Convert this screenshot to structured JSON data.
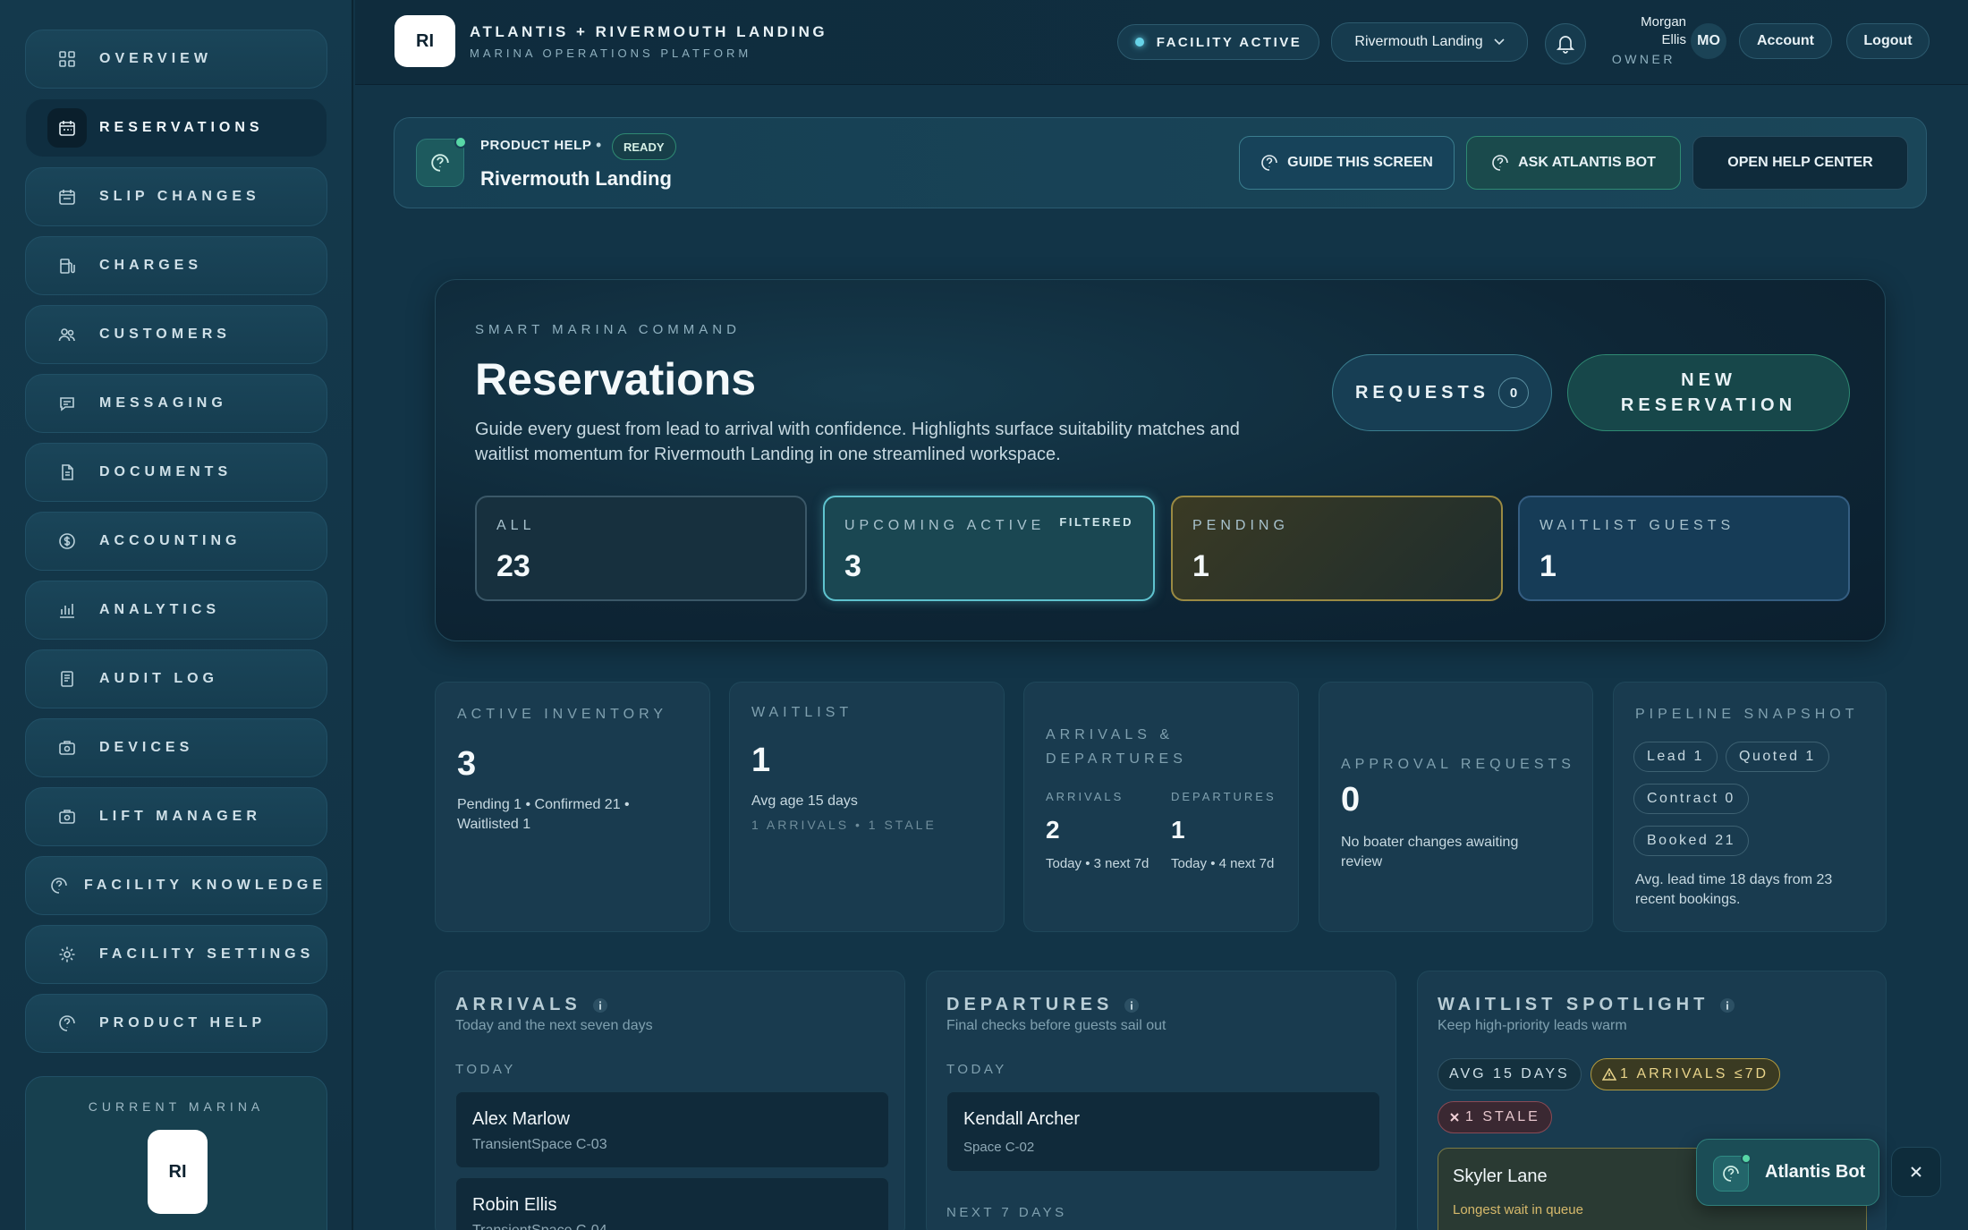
{
  "sidebar": {
    "items": [
      {
        "label": "OVERVIEW",
        "icon": "grid-icon"
      },
      {
        "label": "RESERVATIONS",
        "icon": "calendar-icon",
        "active": true
      },
      {
        "label": "SLIP CHANGES",
        "icon": "calendar-swap-icon"
      },
      {
        "label": "CHARGES",
        "icon": "fuel-icon"
      },
      {
        "label": "CUSTOMERS",
        "icon": "users-icon"
      },
      {
        "label": "MESSAGING",
        "icon": "message-icon"
      },
      {
        "label": "DOCUMENTS",
        "icon": "document-icon"
      },
      {
        "label": "ACCOUNTING",
        "icon": "dollar-icon"
      },
      {
        "label": "ANALYTICS",
        "icon": "chart-icon"
      },
      {
        "label": "AUDIT LOG",
        "icon": "log-icon"
      },
      {
        "label": "DEVICES",
        "icon": "device-icon"
      },
      {
        "label": "LIFT MANAGER",
        "icon": "lift-icon"
      },
      {
        "label": "FACILITY KNOWLEDGE",
        "icon": "help-icon"
      },
      {
        "label": "FACILITY SETTINGS",
        "icon": "gear-icon"
      },
      {
        "label": "PRODUCT HELP",
        "icon": "help-icon"
      }
    ],
    "current_marina": {
      "label": "CURRENT MARINA",
      "logo": "RI"
    }
  },
  "header": {
    "logo": "RI",
    "title": "ATLANTIS + RIVERMOUTH LANDING",
    "subtitle": "MARINA OPERATIONS PLATFORM",
    "facility_status": "FACILITY ACTIVE",
    "marina_select": "Rivermouth Landing",
    "user_name": "Morgan Ellis",
    "user_role": "OWNER",
    "user_initials": "MO",
    "account_label": "Account",
    "logout_label": "Logout"
  },
  "help_bar": {
    "label": "PRODUCT HELP",
    "separator": "•",
    "status": "READY",
    "marina": "Rivermouth Landing",
    "guide_label": "GUIDE THIS SCREEN",
    "ask_label": "ASK ATLANTIS BOT",
    "open_label": "OPEN HELP CENTER"
  },
  "hero": {
    "eyebrow": "SMART MARINA COMMAND",
    "title": "Reservations",
    "description": "Guide every guest from lead to arrival with confidence. Highlights surface suitability matches and waitlist momentum for Rivermouth Landing in one streamlined workspace.",
    "requests_label": "REQUESTS",
    "requests_count": "0",
    "new_reservation_label": "NEW RESERVATION",
    "stats": {
      "all": {
        "label": "ALL",
        "value": "23"
      },
      "upcoming": {
        "label": "UPCOMING ACTIVE",
        "value": "3",
        "filter": "FILTERED"
      },
      "pending": {
        "label": "PENDING",
        "value": "1"
      },
      "waitlist": {
        "label": "WAITLIST GUESTS",
        "value": "1"
      }
    }
  },
  "metrics": {
    "inventory": {
      "label": "ACTIVE INVENTORY",
      "value": "3",
      "sub": "Pending 1 • Confirmed 21 • Waitlisted 1"
    },
    "waitlist": {
      "label": "WAITLIST",
      "value": "1",
      "sub": "Avg age 15 days",
      "muted": "1 ARRIVALS • 1 STALE"
    },
    "arrdep": {
      "label": "ARRIVALS & DEPARTURES",
      "arrivals_label": "ARRIVALS",
      "arrivals_value": "2",
      "arrivals_sub": "Today • 3 next 7d",
      "departures_label": "DEPARTURES",
      "departures_value": "1",
      "departures_sub": "Today • 4 next 7d"
    },
    "approval": {
      "label": "APPROVAL REQUESTS",
      "value": "0",
      "sub": "No boater changes awaiting review"
    },
    "pipeline": {
      "label": "PIPELINE SNAPSHOT",
      "chips": [
        "Lead 1",
        "Quoted 1",
        "Contract 0",
        "Booked 21"
      ],
      "sub": "Avg. lead time 18 days from 23 recent bookings."
    }
  },
  "arrivals": {
    "title": "ARRIVALS",
    "subtitle": "Today and the next seven days",
    "section": "TODAY",
    "rows": [
      {
        "name": "Alex Marlow",
        "space": "TransientSpace C-03"
      },
      {
        "name": "Robin Ellis",
        "space": "TransientSpace C-04"
      }
    ]
  },
  "departures": {
    "title": "DEPARTURES",
    "subtitle": "Final checks before guests sail out",
    "section_today": "TODAY",
    "section_next": "NEXT 7 DAYS",
    "rows": [
      {
        "name": "Kendall Archer",
        "space": "Space C-02"
      }
    ]
  },
  "spotlight": {
    "title": "WAITLIST SPOTLIGHT",
    "subtitle": "Keep high-priority leads warm",
    "chip_avg": "AVG 15 DAYS",
    "chip_arrivals": "1 ARRIVALS ≤7D",
    "chip_stale": "1 STALE",
    "card_name": "Skyler Lane",
    "card_note": "Longest wait in queue"
  },
  "bot": {
    "label": "Atlantis Bot"
  },
  "colors": {
    "accent": "#67d3e8",
    "success": "#58d6a6",
    "warning": "#d6b96b",
    "danger": "#e07a7a"
  }
}
